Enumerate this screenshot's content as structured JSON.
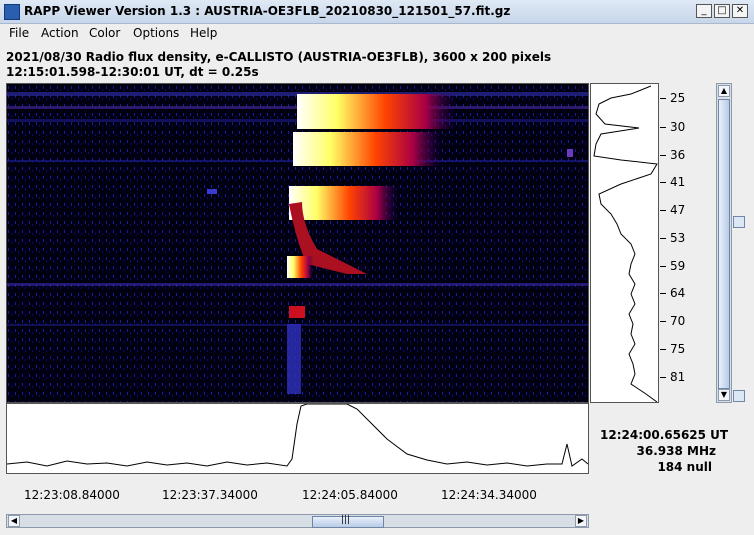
{
  "window": {
    "title": "RAPP Viewer Version 1.3 : AUSTRIA-OE3FLB_20210830_121501_57.fit.gz",
    "minimize_glyph": "_",
    "maximize_glyph": "□",
    "close_glyph": "✕"
  },
  "menu": [
    "File",
    "Action",
    "Color",
    "Options",
    "Help"
  ],
  "info": {
    "line1": "2021/08/30  Radio flux density, e-CALLISTO (AUSTRIA-OE3FLB),  3600 x 200 pixels",
    "line2": "12:15:01.598-12:30:01 UT,  dt = 0.25s"
  },
  "frequency_axis": [
    "25",
    "30",
    "36",
    "41",
    "47",
    "53",
    "59",
    "64",
    "70",
    "75",
    "81"
  ],
  "time_axis": [
    "12:23:08.84000",
    "12:23:37.34000",
    "12:24:05.84000",
    "12:24:34.34000"
  ],
  "readout": {
    "time": "12:24:00.65625 UT",
    "frequency": "36.938 MHz",
    "value": "184 null"
  },
  "icons": {
    "scroll_left": "◀",
    "scroll_right": "▶",
    "scroll_up": "▲",
    "scroll_down": "▼",
    "grip": "|||"
  },
  "colors": {
    "background": "#000000",
    "low": "#0000aa",
    "mid": "#cc0000",
    "high": "#ffff66",
    "peak": "#ffffff"
  }
}
